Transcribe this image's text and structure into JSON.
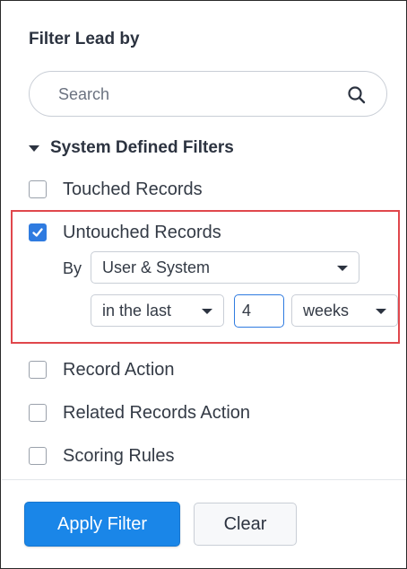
{
  "header": {
    "title": "Filter Lead by"
  },
  "search": {
    "placeholder": "Search",
    "icon": "search-icon"
  },
  "section": {
    "label": "System Defined Filters",
    "expanded": true
  },
  "filters": [
    {
      "label": "Touched Records",
      "checked": false
    },
    {
      "label": "Untouched Records",
      "checked": true
    },
    {
      "label": "Record Action",
      "checked": false
    },
    {
      "label": "Related Records Action",
      "checked": false
    },
    {
      "label": "Scoring Rules",
      "checked": false
    }
  ],
  "untouched_options": {
    "by_label": "By",
    "by_value": "User & System",
    "period_value": "in the last",
    "count_value": "4",
    "unit_value": "weeks"
  },
  "footer": {
    "apply_label": "Apply Filter",
    "clear_label": "Clear"
  },
  "colors": {
    "accent": "#1a86e8",
    "checkbox_checked": "#2f7be0",
    "highlight": "#e0474c"
  }
}
